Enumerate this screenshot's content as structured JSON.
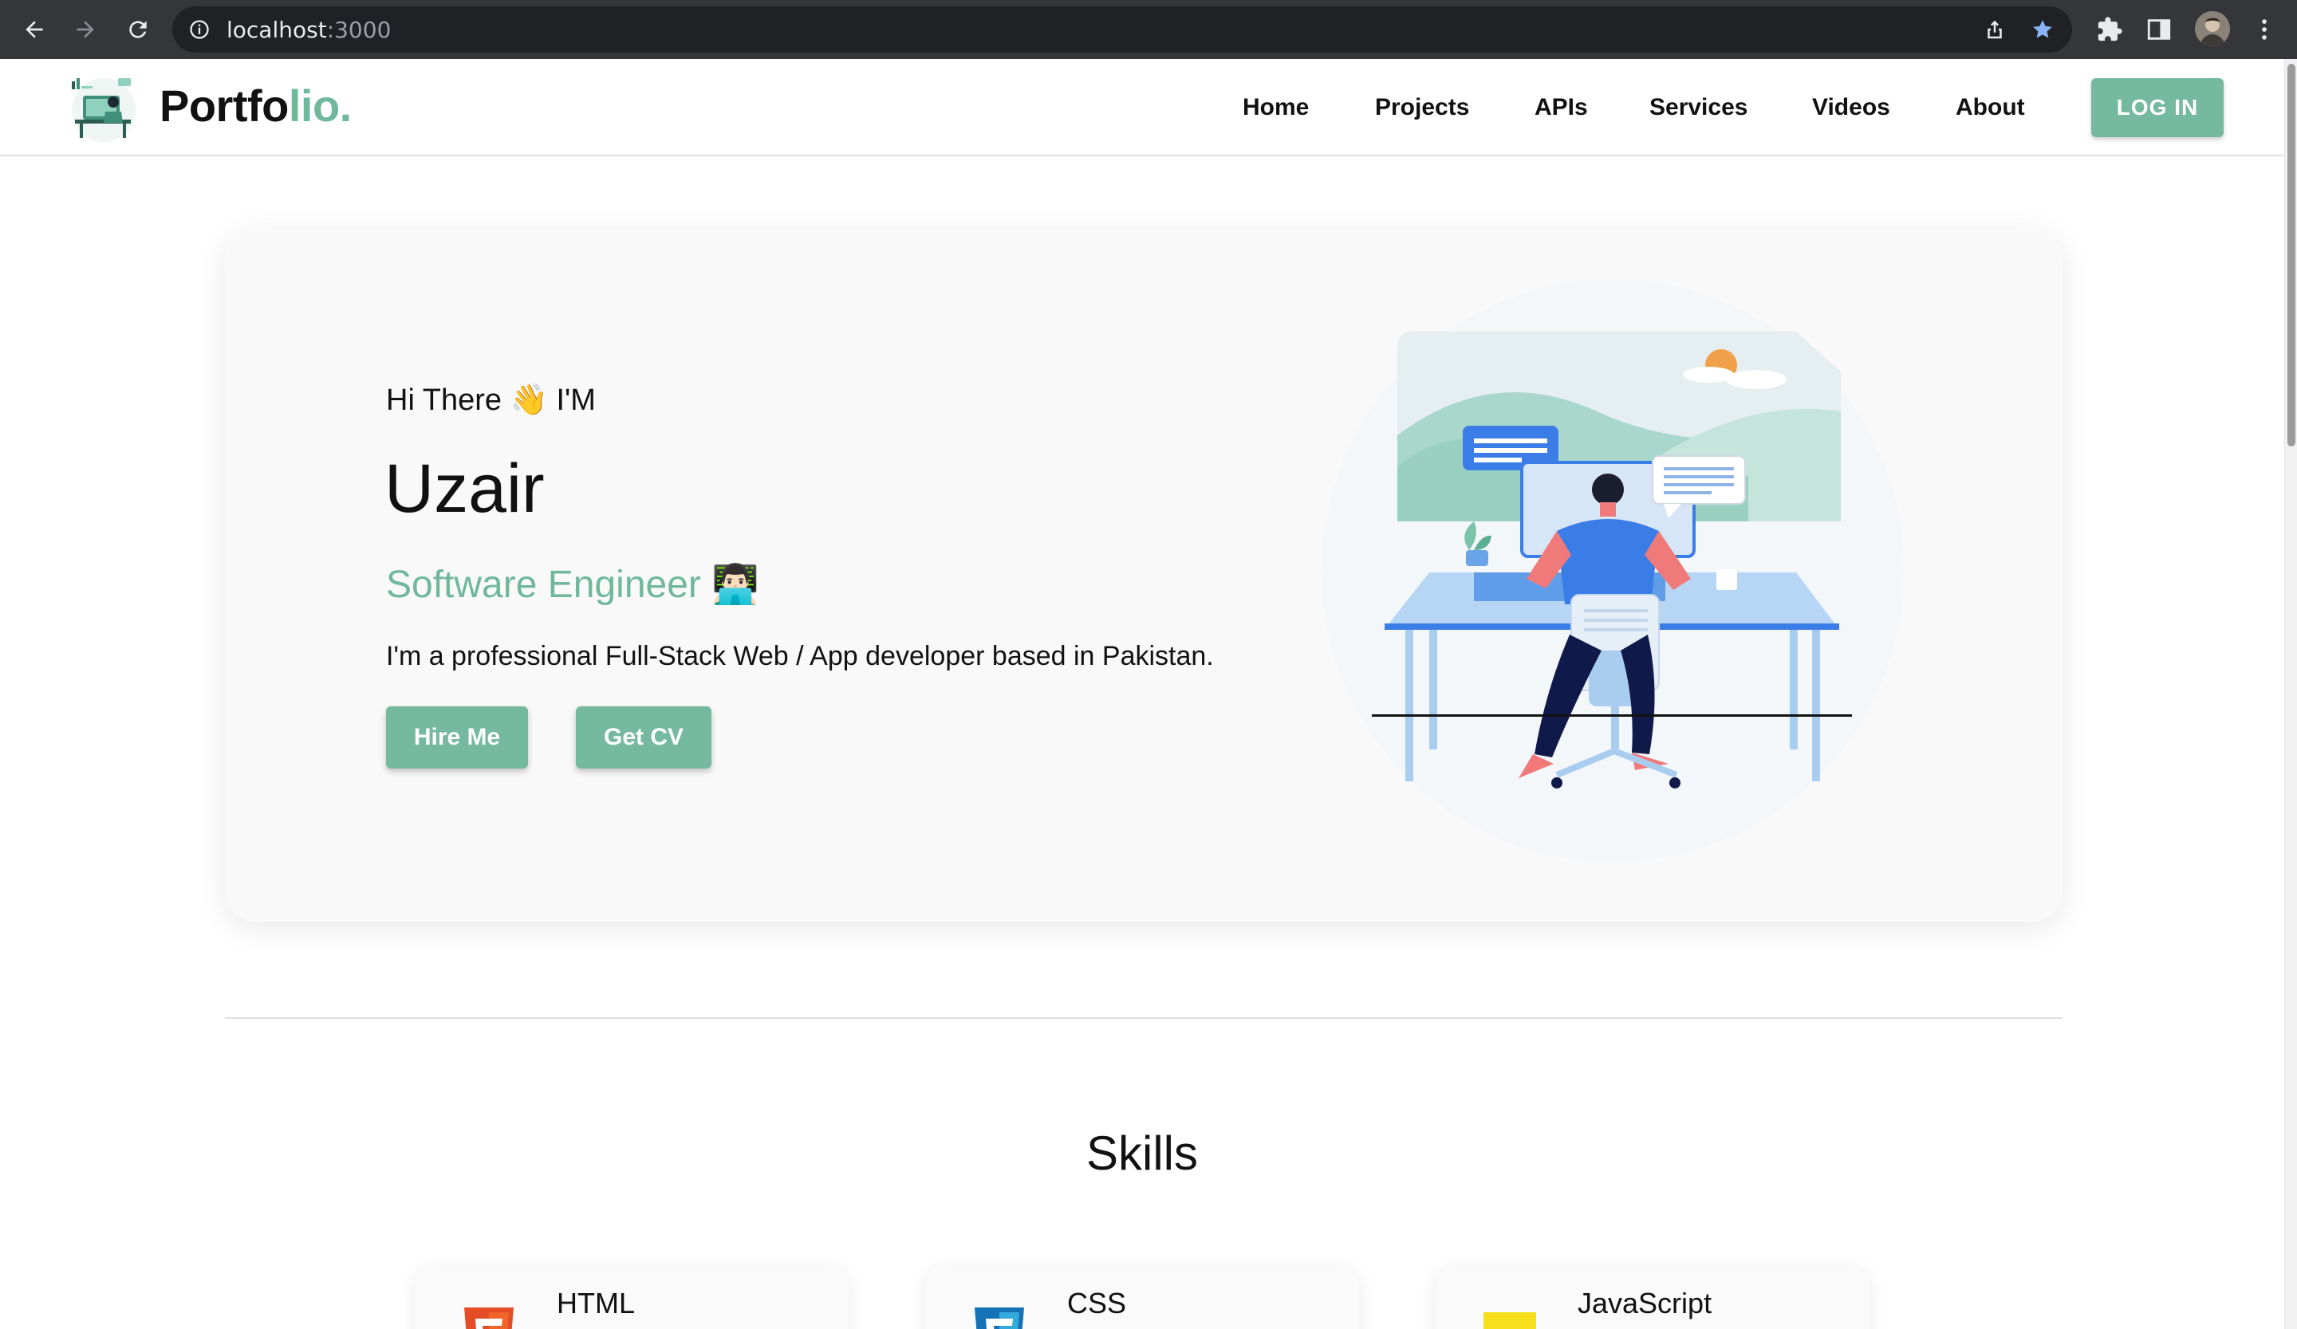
{
  "browser": {
    "url_host": "localhost",
    "url_port": ":3000"
  },
  "navbar": {
    "logo_main": "Portfo",
    "logo_accent": "lio.",
    "links": [
      {
        "label": "Home"
      },
      {
        "label": "Projects"
      },
      {
        "label": "APIs"
      },
      {
        "label": "Services"
      },
      {
        "label": "Videos"
      },
      {
        "label": "About"
      }
    ],
    "login_label": "LOG IN"
  },
  "hero": {
    "greeting": "Hi There 👋 I'M",
    "name": "Uzair",
    "role": "Software Engineer 👨🏻‍💻",
    "bio": "I'm a professional Full-Stack Web / App developer based in Pakistan.",
    "hire_label": "Hire Me",
    "cv_label": "Get CV"
  },
  "skills": {
    "title": "Skills",
    "items": [
      {
        "name": "HTML",
        "icon": "html5-icon",
        "color": "#e44d26"
      },
      {
        "name": "CSS",
        "icon": "css3-icon",
        "color": "#1572b6"
      },
      {
        "name": "JavaScript",
        "icon": "javascript-icon",
        "color": "#f7df1e"
      }
    ]
  },
  "colors": {
    "accent": "#75b9a0",
    "accent_text": "#6fb89c",
    "chrome": "#35363a"
  }
}
